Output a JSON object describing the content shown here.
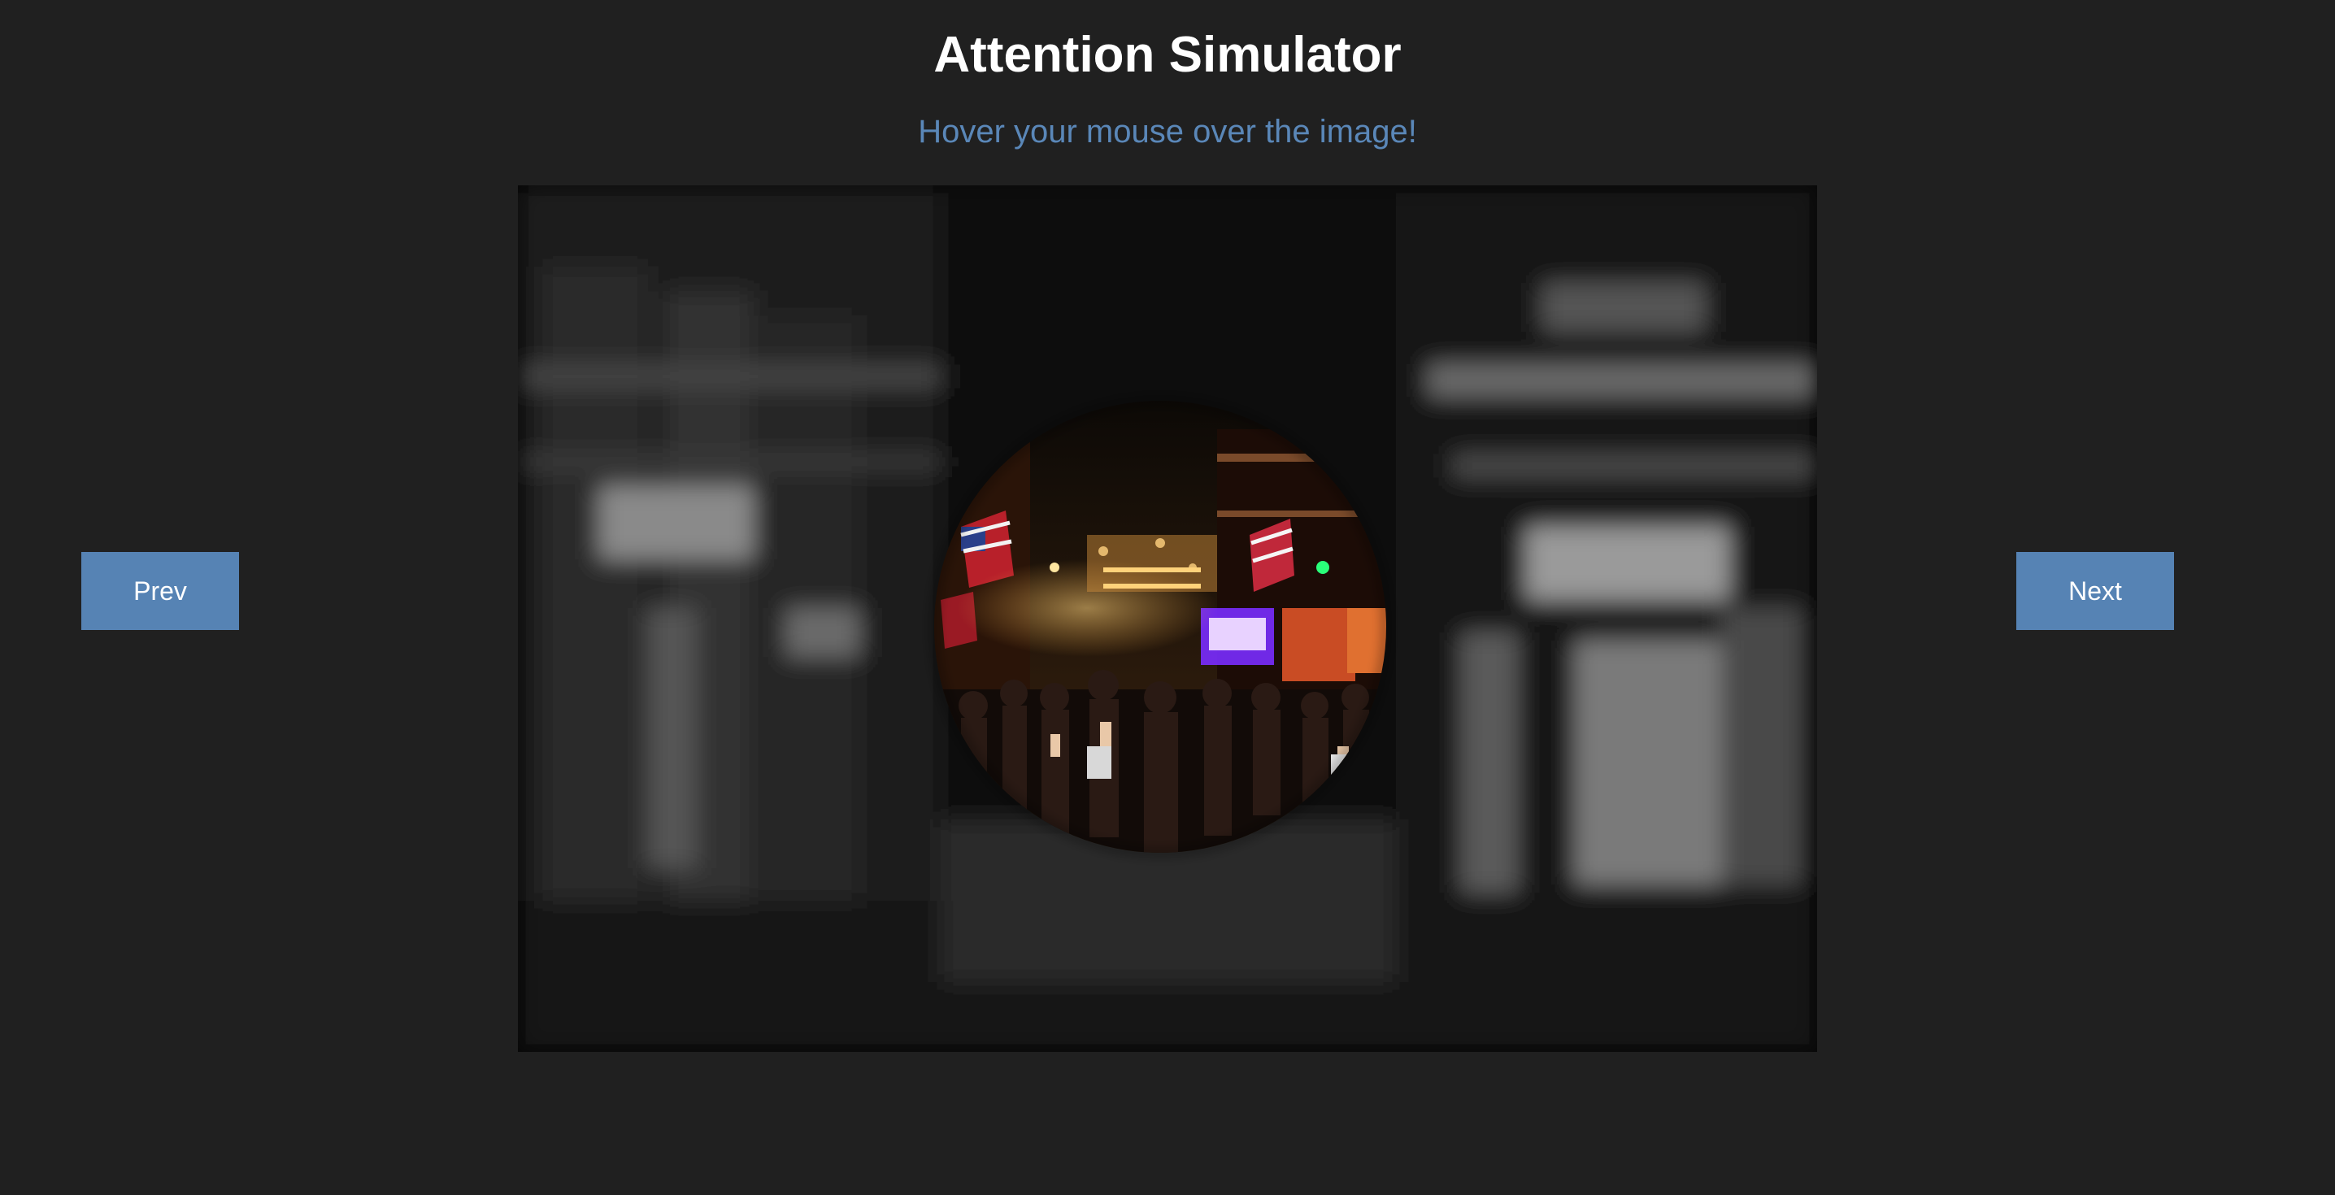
{
  "header": {
    "title": "Attention Simulator",
    "subtitle": "Hover your mouse over the image!"
  },
  "nav": {
    "prev_label": "Prev",
    "next_label": "Next"
  },
  "viewer": {
    "image_description_icon": "street-scene-image",
    "focus_shape": "circle",
    "outside_effect": "blurred-grayscale"
  },
  "colors": {
    "background": "#202020",
    "title": "#ffffff",
    "subtitle": "#5a87b8",
    "button": "#5683b4",
    "button_text": "#ffffff"
  }
}
